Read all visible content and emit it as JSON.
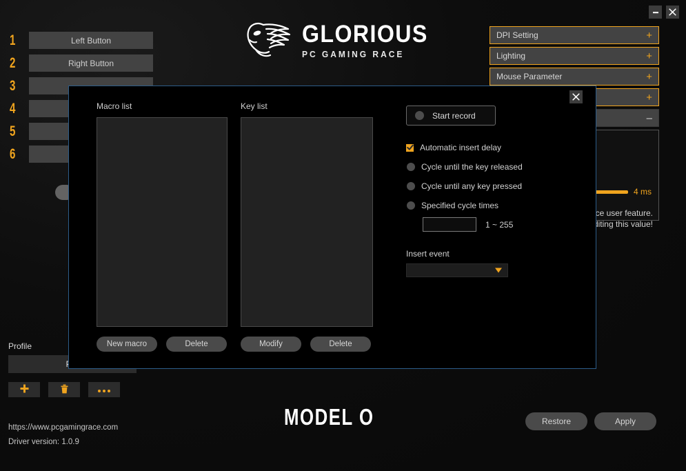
{
  "window": {
    "minimize_label": "minimize",
    "close_label": "close"
  },
  "brand": {
    "name": "GLORIOUS",
    "tagline": "PC GAMING RACE",
    "icon": "glorious-lion-logo"
  },
  "key_assignments": {
    "rows": [
      {
        "num": "1",
        "label": "Left Button"
      },
      {
        "num": "2",
        "label": "Right Button"
      },
      {
        "num": "3",
        "label": ""
      },
      {
        "num": "4",
        "label": ""
      },
      {
        "num": "5",
        "label": ""
      },
      {
        "num": "6",
        "label": ""
      }
    ]
  },
  "accordion": {
    "items": [
      {
        "label": "DPI Setting",
        "sign": "+",
        "expanded": false
      },
      {
        "label": "Lighting",
        "sign": "+",
        "expanded": false
      },
      {
        "label": "Mouse Parameter",
        "sign": "+",
        "expanded": false
      },
      {
        "label": "",
        "sign": "+",
        "expanded": false
      },
      {
        "label": "",
        "sign": "–",
        "expanded": true
      }
    ],
    "panel": {
      "slider_value": "4 ms",
      "warning_line1": "ce user feature.",
      "warning_line2": "diting this value!"
    }
  },
  "profile": {
    "label": "Profile",
    "selected": "Pro",
    "add_icon": "plus-icon",
    "delete_icon": "trash-icon",
    "more_icon": "ellipsis-icon"
  },
  "footer": {
    "website": "https://www.pcgamingrace.com",
    "driver_version": "Driver version: 1.0.9",
    "model": "MODEL O",
    "restore_label": "Restore",
    "apply_label": "Apply"
  },
  "dialog": {
    "close_label": "close",
    "macro_list": {
      "title": "Macro list",
      "items": [],
      "new_label": "New macro",
      "delete_label": "Delete"
    },
    "key_list": {
      "title": "Key list",
      "items": [],
      "modify_label": "Modify",
      "delete_label": "Delete"
    },
    "record_button": "Start record",
    "options": [
      {
        "type": "checkbox",
        "label": "Automatic insert delay",
        "checked": true
      },
      {
        "type": "radio",
        "label": "Cycle until the key released",
        "checked": false
      },
      {
        "type": "radio",
        "label": "Cycle until any key pressed",
        "checked": false
      },
      {
        "type": "radio",
        "label": "Specified cycle times",
        "checked": false
      }
    ],
    "cycle_times_value": "",
    "cycle_times_hint": "1 ~ 255",
    "insert_event_label": "Insert event",
    "insert_event_value": ""
  },
  "colors": {
    "accent": "#f0a41e",
    "dialog_border": "#2d5d8a",
    "button_grey": "#4a4a4a",
    "background": "#0b0b0b"
  }
}
